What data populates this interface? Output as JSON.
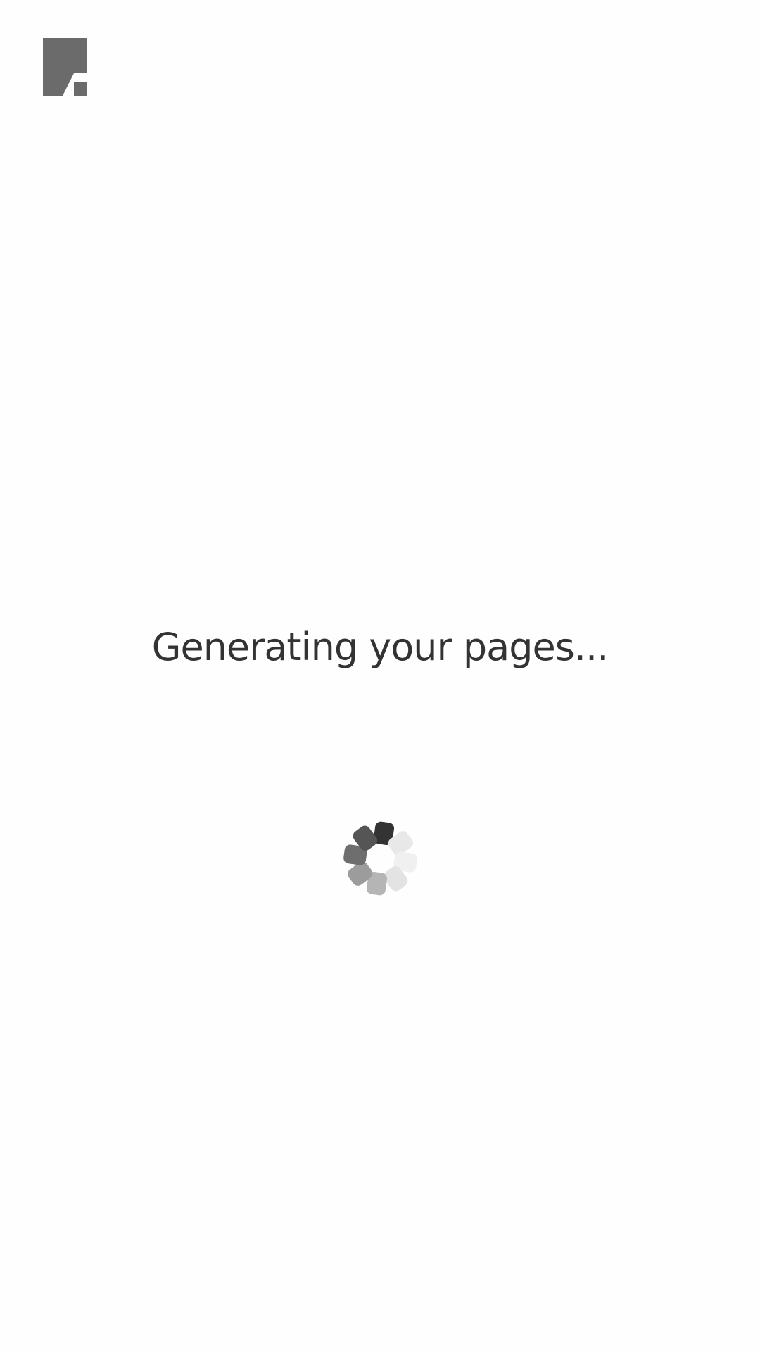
{
  "app": {
    "logo_icon": "document-page-icon",
    "logo_color": "#6b6b6b"
  },
  "loading": {
    "message": "Generating your pages...",
    "spinner_icon": "loading-spinner-icon",
    "spinner_segments": [
      {
        "color": "#333333"
      },
      {
        "color": "#e8e8e8"
      },
      {
        "color": "#f0f0f0"
      },
      {
        "color": "#e3e3e3"
      },
      {
        "color": "#b5b5b5"
      },
      {
        "color": "#9c9c9c"
      },
      {
        "color": "#6e6e6e"
      },
      {
        "color": "#555555"
      }
    ]
  }
}
